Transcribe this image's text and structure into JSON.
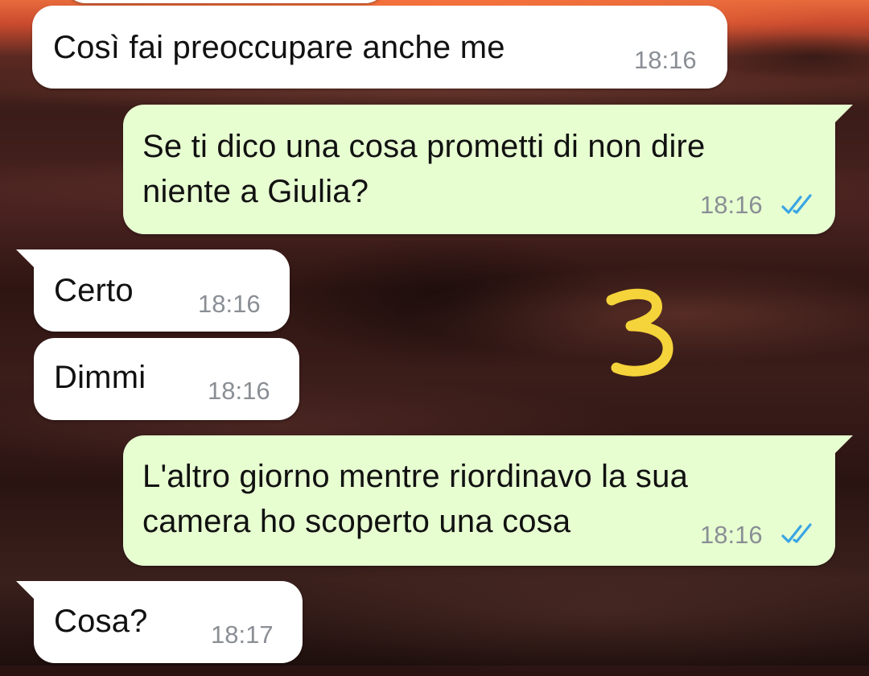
{
  "chat": {
    "messages": [
      {
        "id": 1,
        "direction": "incoming",
        "text": "Così fai preoccupare anche me",
        "time": "18:16"
      },
      {
        "id": 2,
        "direction": "outgoing",
        "text": "Se ti dico una cosa prometti di non dire\nniente a Giulia?",
        "time": "18:16",
        "status": "read"
      },
      {
        "id": 3,
        "direction": "incoming",
        "text": "Certo",
        "time": "18:16"
      },
      {
        "id": 4,
        "direction": "incoming",
        "text": "Dimmi",
        "time": "18:16"
      },
      {
        "id": 5,
        "direction": "outgoing",
        "text": "L'altro giorno mentre riordinavo la sua\ncamera ho scoperto una cosa",
        "time": "18:16",
        "status": "read"
      },
      {
        "id": 6,
        "direction": "incoming",
        "text": "Cosa?",
        "time": "18:17"
      }
    ]
  },
  "overlay": {
    "number": "3",
    "color": "#f5d33a"
  },
  "colors": {
    "incoming_bubble": "#ffffff",
    "outgoing_bubble": "#e7fed1",
    "timestamp": "#8a8f95",
    "read_ticks": "#3aa5e3"
  },
  "icons": {
    "read_receipt": "double-check-icon"
  }
}
